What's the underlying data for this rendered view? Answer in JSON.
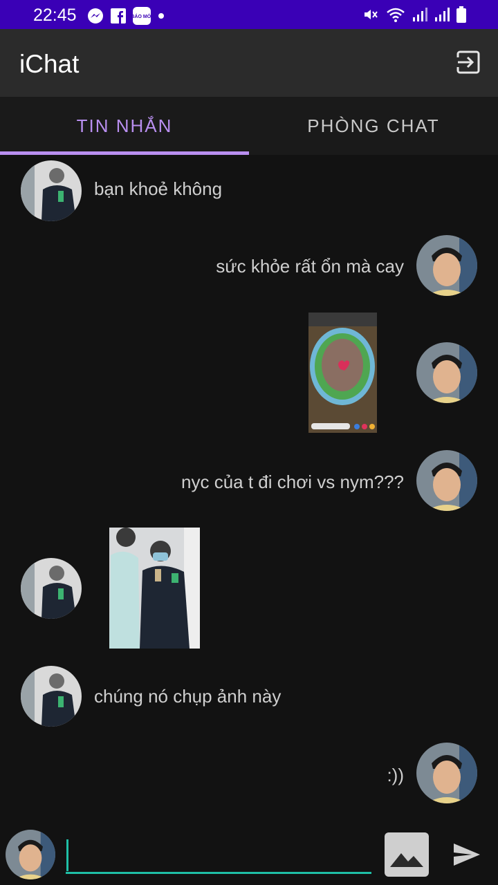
{
  "status_bar": {
    "time": "22:45",
    "left_icons": [
      "messenger-icon",
      "facebook-icon",
      "bao-moi-icon",
      "dot-icon"
    ],
    "bao_moi_label": "BÁO MỚI",
    "right_icons": [
      "mute-icon",
      "wifi-icon",
      "signal-icon",
      "signal-icon",
      "battery-icon"
    ]
  },
  "app_bar": {
    "title": "iChat",
    "exit_icon": "exit-icon"
  },
  "tabs": [
    {
      "label": "TIN NHẮN",
      "selected": true
    },
    {
      "label": "PHÒNG CHAT",
      "selected": false
    }
  ],
  "messages": [
    {
      "side": "left",
      "type": "text",
      "text": "bạn khoẻ không"
    },
    {
      "side": "right",
      "type": "text",
      "text": "sức khỏe rất ổn mà cay"
    },
    {
      "side": "right",
      "type": "image",
      "description": "food-photo"
    },
    {
      "side": "right",
      "type": "text",
      "text": "nyc của t đi chơi vs nym???"
    },
    {
      "side": "left",
      "type": "image",
      "description": "people-photo"
    },
    {
      "side": "left",
      "type": "text",
      "text": "chúng nó chụp ảnh này"
    },
    {
      "side": "right",
      "type": "text",
      "text": ":))"
    }
  ],
  "composer": {
    "input_value": "",
    "image_icon": "image-icon",
    "send_icon": "send-icon"
  },
  "colors": {
    "status_bar": "#3a00b6",
    "app_bar": "#2b2b2b",
    "accent": "#b98ff0",
    "input_underline": "#1fbfa6",
    "background": "#121212"
  }
}
